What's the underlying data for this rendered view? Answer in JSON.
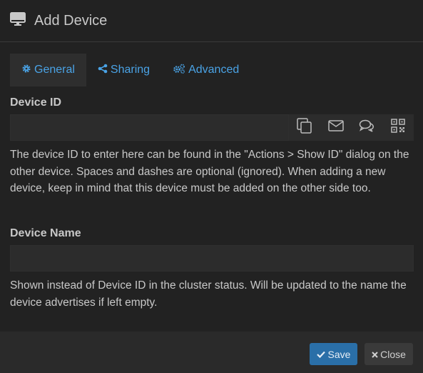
{
  "dialog": {
    "title": "Add Device"
  },
  "tabs": [
    {
      "label": "General",
      "icon": "gear-icon",
      "active": true
    },
    {
      "label": "Sharing",
      "icon": "share-icon",
      "active": false
    },
    {
      "label": "Advanced",
      "icon": "cogs-icon",
      "active": false
    }
  ],
  "device_id": {
    "label": "Device ID",
    "value": "",
    "help": "The device ID to enter here can be found in the \"Actions > Show ID\" dialog on the other device. Spaces and dashes are optional (ignored). When adding a new device, keep in mind that this device must be added on the other side too.",
    "actions": [
      "copy-icon",
      "mail-icon",
      "chat-icon",
      "qr-code-icon"
    ]
  },
  "device_name": {
    "label": "Device Name",
    "value": "",
    "help": "Shown instead of Device ID in the cluster status. Will be updated to the name the device advertises if left empty."
  },
  "footer": {
    "save_label": "Save",
    "close_label": "Close"
  },
  "colors": {
    "accent": "#4aa3e6",
    "primary_button": "#2a6fa8",
    "background": "#222222"
  }
}
